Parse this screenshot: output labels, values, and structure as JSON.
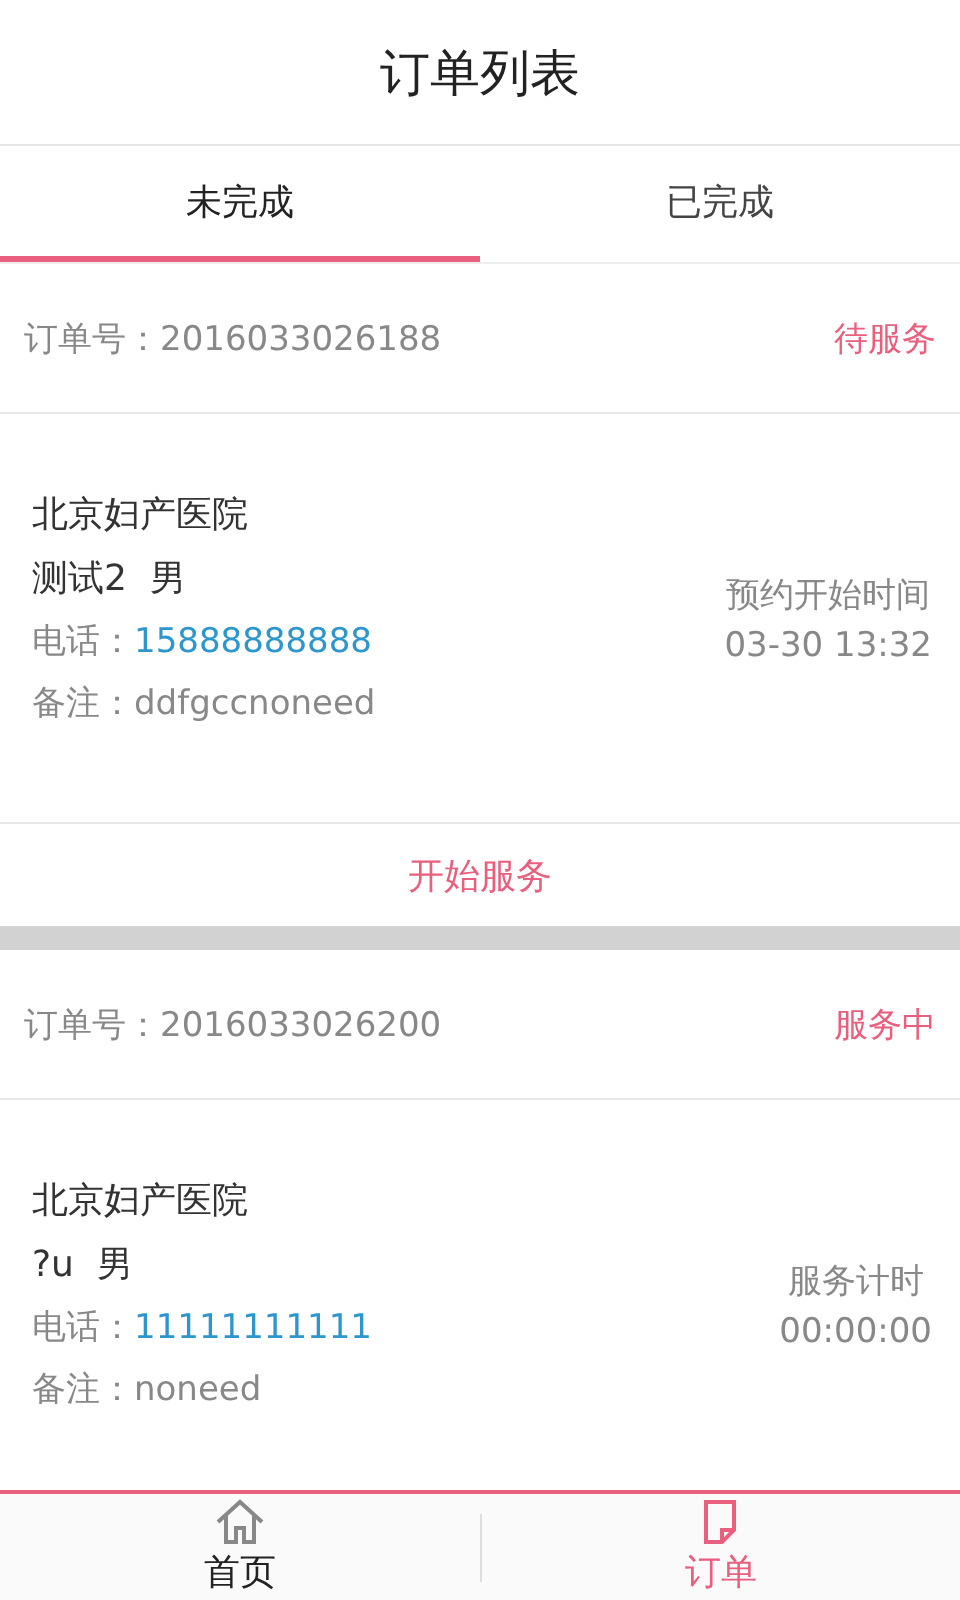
{
  "header": {
    "title": "订单列表"
  },
  "tabs": [
    {
      "label": "未完成",
      "selected": true
    },
    {
      "label": "已完成",
      "selected": false
    }
  ],
  "orders": [
    {
      "order_label": "订单号：",
      "order_no": "2016033026188",
      "status": "待服务",
      "hospital": "北京妇产医院",
      "patient": "测试2  男",
      "phone_label": "电话：",
      "phone": "15888888888",
      "note_label": "备注：",
      "note": "ddfgccnoneed",
      "time_label": "预约开始时间",
      "time": "03-30 13:32",
      "action": "开始服务"
    },
    {
      "order_label": "订单号：",
      "order_no": "2016033026200",
      "status": "服务中",
      "hospital": "北京妇产医院",
      "patient": "?u  男",
      "phone_label": "电话：",
      "phone": "11111111111",
      "note_label": "备注：",
      "note": "noneed",
      "time_label": "服务计时",
      "time": "00:00:00"
    }
  ],
  "nav": [
    {
      "label": "首页",
      "kind": "home",
      "selected": false
    },
    {
      "label": "订单",
      "kind": "order",
      "selected": true
    }
  ]
}
